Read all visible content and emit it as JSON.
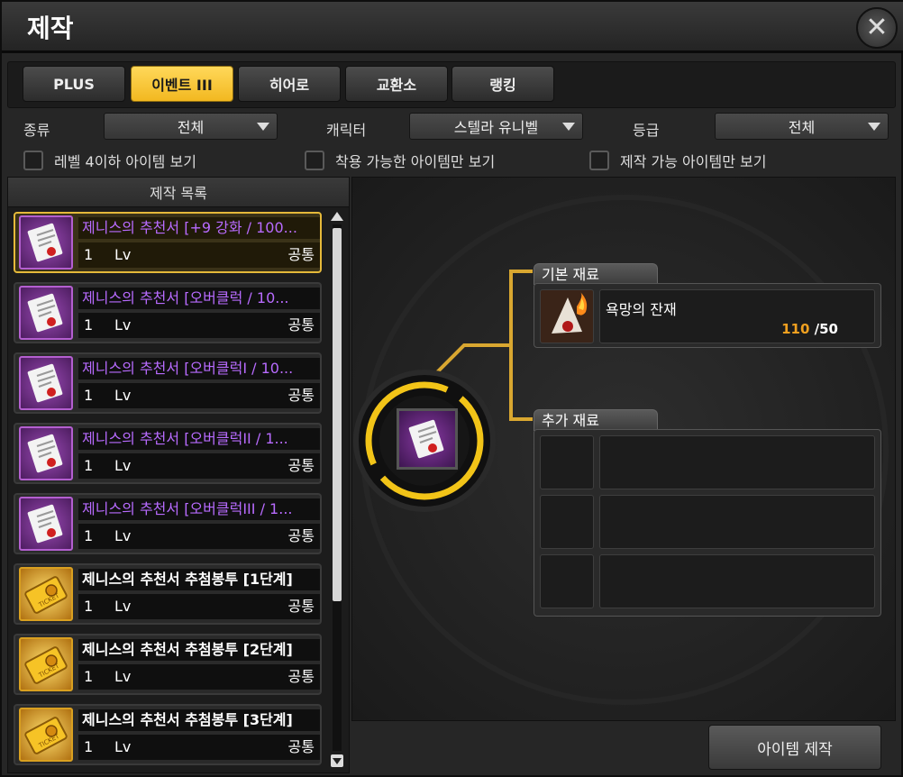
{
  "window": {
    "title": "제작"
  },
  "tabs": [
    {
      "label": "PLUS",
      "active": false
    },
    {
      "label": "이벤트 III",
      "active": true
    },
    {
      "label": "히어로",
      "active": false
    },
    {
      "label": "교환소",
      "active": false
    },
    {
      "label": "랭킹",
      "active": false
    }
  ],
  "filters": {
    "type_label": "종류",
    "type_value": "전체",
    "character_label": "캐릭터",
    "character_value": "스텔라 유니벨",
    "grade_label": "등급",
    "grade_value": "전체"
  },
  "checkboxes": [
    {
      "label": "레벨 4이하 아이템 보기",
      "checked": false
    },
    {
      "label": "착용 가능한 아이템만 보기",
      "checked": false
    },
    {
      "label": "제작 가능 아이템만 보기",
      "checked": false
    }
  ],
  "list": {
    "header": "제작 목록",
    "items": [
      {
        "name": "제니스의 추천서 [+9 강화 / 100...",
        "level": "1",
        "lv_label": "Lv",
        "class": "공통",
        "icon": "scroll-icon",
        "rarity": "purple",
        "selected": true
      },
      {
        "name": "제니스의 추천서 [오버클럭 / 10...",
        "level": "1",
        "lv_label": "Lv",
        "class": "공통",
        "icon": "scroll-icon",
        "rarity": "purple",
        "selected": false
      },
      {
        "name": "제니스의 추천서 [오버클럭I / 10...",
        "level": "1",
        "lv_label": "Lv",
        "class": "공통",
        "icon": "scroll-icon",
        "rarity": "purple",
        "selected": false
      },
      {
        "name": "제니스의 추천서 [오버클럭II / 1...",
        "level": "1",
        "lv_label": "Lv",
        "class": "공통",
        "icon": "scroll-icon",
        "rarity": "purple",
        "selected": false
      },
      {
        "name": "제니스의 추천서 [오버클럭III / 1...",
        "level": "1",
        "lv_label": "Lv",
        "class": "공통",
        "icon": "scroll-icon",
        "rarity": "purple",
        "selected": false
      },
      {
        "name": "제니스의 추천서 추첨봉투 [1단계]",
        "level": "1",
        "lv_label": "Lv",
        "class": "공통",
        "icon": "ticket-icon",
        "rarity": "white",
        "selected": false
      },
      {
        "name": "제니스의 추천서 추첨봉투 [2단계]",
        "level": "1",
        "lv_label": "Lv",
        "class": "공통",
        "icon": "ticket-icon",
        "rarity": "white",
        "selected": false
      },
      {
        "name": "제니스의 추천서 추첨봉투 [3단계]",
        "level": "1",
        "lv_label": "Lv",
        "class": "공통",
        "icon": "ticket-icon",
        "rarity": "white",
        "selected": false
      }
    ]
  },
  "materials": {
    "basic_label": "기본 재료",
    "basic": {
      "name": "욕망의 잔재",
      "have": "110",
      "need": "/50",
      "icon": "burning-paper-icon"
    },
    "extra_label": "추가 재료"
  },
  "craft_button": "아이템 제작",
  "colors": {
    "accent": "#f2b820",
    "rare_purple": "#b86bff",
    "have_count": "#f0a020"
  }
}
